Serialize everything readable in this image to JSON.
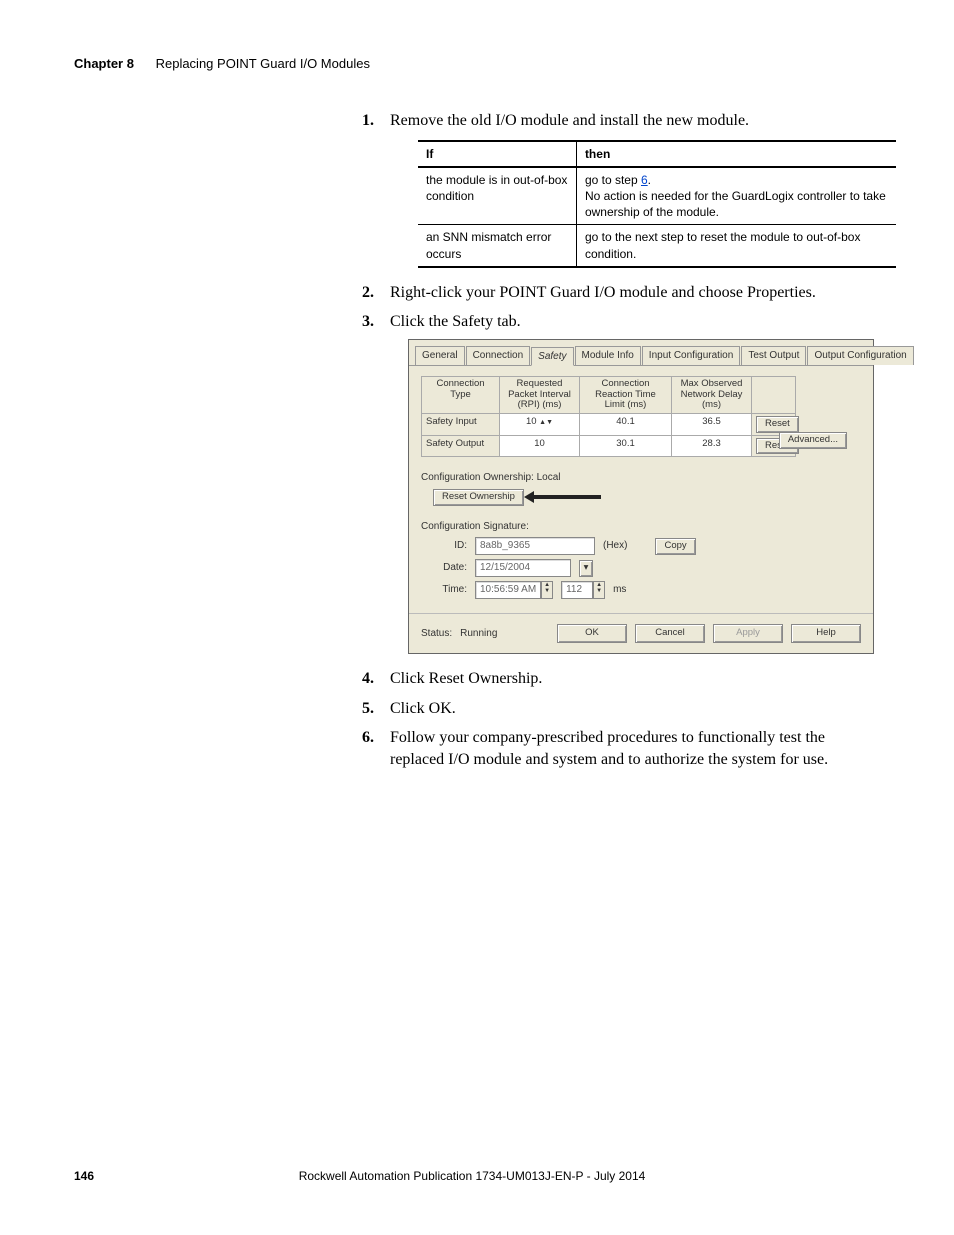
{
  "header": {
    "chapter": "Chapter 8",
    "title": "Replacing POINT Guard I/O Modules"
  },
  "steps": {
    "s1": "Remove the old I/O module and install the new module.",
    "s2": "Right-click your POINT Guard I/O module and choose Properties.",
    "s3": "Click the Safety tab.",
    "s4": "Click Reset Ownership.",
    "s5": "Click OK.",
    "s6": "Follow your company-prescribed procedures to functionally test the replaced I/O module and system and to authorize the system for use."
  },
  "cond_table": {
    "head_if": "If",
    "head_then": "then",
    "r1_if": "the module is in out-of-box condition",
    "r1_then_prefix": "go to step ",
    "r1_then_link": "6",
    "r1_then_suffix": ".",
    "r1_then_line2": "No action is needed for the GuardLogix controller to take ownership of the module.",
    "r2_if": "an SNN mismatch error occurs",
    "r2_then": "go to the next step to reset the module to out-of-box condition."
  },
  "dialog": {
    "tabs": {
      "general": "General",
      "connection": "Connection",
      "safety": "Safety",
      "module_info": "Module Info",
      "input_config": "Input Configuration",
      "test_output": "Test Output",
      "output_config": "Output Configuration"
    },
    "grid": {
      "h_conn_type": "Connection Type",
      "h_rpi": "Requested Packet Interval (RPI) (ms)",
      "h_crtl": "Connection Reaction Time Limit (ms)",
      "h_mond": "Max Observed Network Delay (ms)",
      "row1_label": "Safety Input",
      "row1_rpi": "10",
      "row1_crtl": "40.1",
      "row1_mond": "36.5",
      "row2_label": "Safety Output",
      "row2_rpi": "10",
      "row2_crtl": "30.1",
      "row2_mond": "28.3",
      "reset_btn": "Reset"
    },
    "advanced_btn": "Advanced...",
    "ownership_label": "Configuration Ownership: Local",
    "reset_ownership_btn": "Reset Ownership",
    "config_sig_label": "Configuration Signature:",
    "sig_id_label": "ID:",
    "sig_id_value": "8a8b_9365",
    "sig_id_hex": "(Hex)",
    "copy_btn": "Copy",
    "sig_date_label": "Date:",
    "sig_date_value": "12/15/2004",
    "sig_time_label": "Time:",
    "sig_time_value": "10:56:59 AM",
    "sig_time_ms": "112",
    "sig_time_ms_unit": "ms",
    "status_label": "Status:",
    "status_value": "Running",
    "ok_btn": "OK",
    "cancel_btn": "Cancel",
    "apply_btn": "Apply",
    "help_btn": "Help"
  },
  "footer": {
    "page": "146",
    "publication": "Rockwell Automation Publication 1734-UM013J-EN-P - July 2014"
  }
}
